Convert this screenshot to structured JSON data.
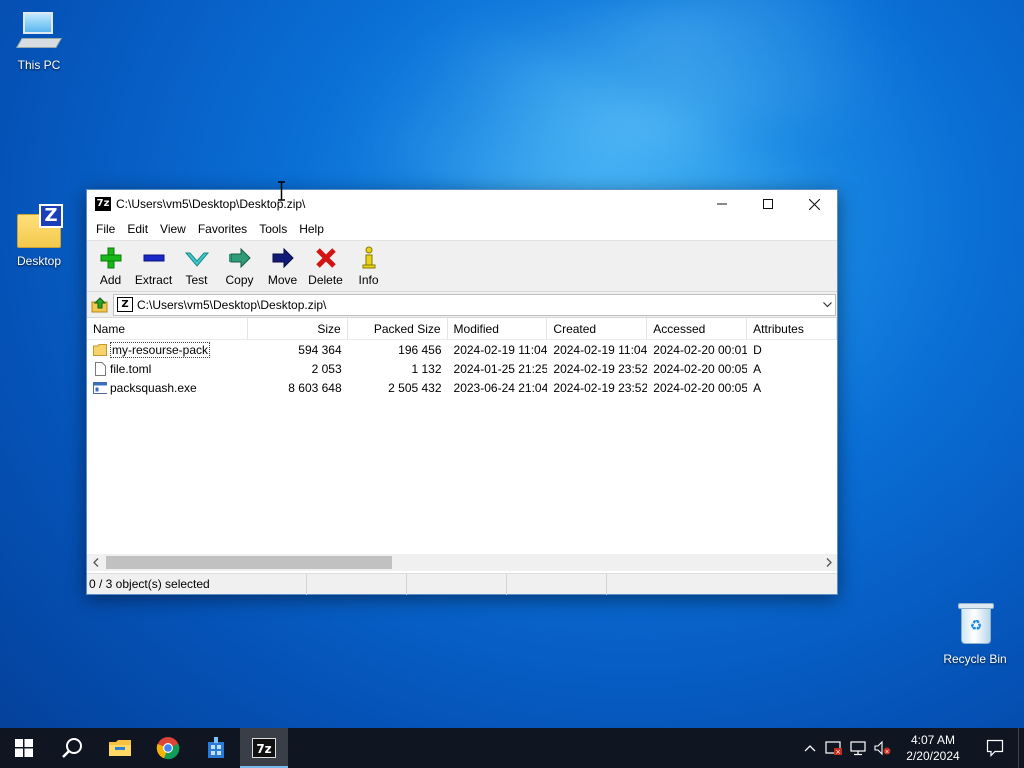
{
  "desktop": {
    "icons": [
      {
        "label": "This PC",
        "icon": "this-pc-icon"
      },
      {
        "label": "Desktop",
        "icon": "zip-archive-icon"
      },
      {
        "label": "Recycle Bin",
        "icon": "recycle-bin-icon"
      }
    ]
  },
  "window": {
    "title": "C:\\Users\\vm5\\Desktop\\Desktop.zip\\",
    "app_icon_text": "7z",
    "menu": [
      "File",
      "Edit",
      "View",
      "Favorites",
      "Tools",
      "Help"
    ],
    "toolbar": [
      {
        "label": "Add",
        "icon": "add-icon"
      },
      {
        "label": "Extract",
        "icon": "extract-icon"
      },
      {
        "label": "Test",
        "icon": "test-icon"
      },
      {
        "label": "Copy",
        "icon": "copy-icon"
      },
      {
        "label": "Move",
        "icon": "move-icon"
      },
      {
        "label": "Delete",
        "icon": "delete-icon"
      },
      {
        "label": "Info",
        "icon": "info-icon"
      }
    ],
    "address": "C:\\Users\\vm5\\Desktop\\Desktop.zip\\",
    "columns": [
      "Name",
      "Size",
      "Packed Size",
      "Modified",
      "Created",
      "Accessed",
      "Attributes"
    ],
    "rows": [
      {
        "name": "my-resourse-pack",
        "type": "folder",
        "size": "594 364",
        "packed": "196 456",
        "modified": "2024-02-19 11:04",
        "created": "2024-02-19 11:04",
        "accessed": "2024-02-20 00:01",
        "attr": "D"
      },
      {
        "name": "file.toml",
        "type": "file",
        "size": "2 053",
        "packed": "1 132",
        "modified": "2024-01-25 21:25",
        "created": "2024-02-19 23:52",
        "accessed": "2024-02-20 00:05",
        "attr": "A"
      },
      {
        "name": "packsquash.exe",
        "type": "exe",
        "size": "8 603 648",
        "packed": "2 505 432",
        "modified": "2023-06-24 21:04",
        "created": "2024-02-19 23:52",
        "accessed": "2024-02-20 00:05",
        "attr": "A"
      }
    ],
    "status": "0 / 3 object(s) selected"
  },
  "taskbar": {
    "apps": [
      "start",
      "search",
      "file-explorer",
      "chrome",
      "app-installer",
      "7zip"
    ],
    "clock_time": "4:07 AM",
    "clock_date": "2/20/2024"
  },
  "colors": {
    "accent": "#0078d7",
    "taskbar": "#0f1622"
  }
}
